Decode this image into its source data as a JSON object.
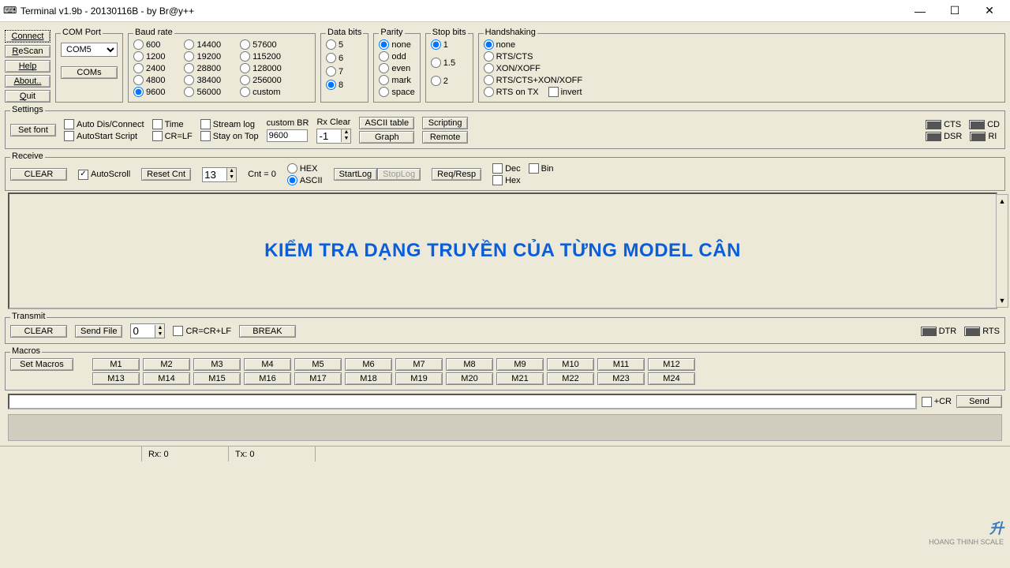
{
  "window": {
    "title": "Terminal v1.9b - 20130116B - by Br@y++"
  },
  "leftbuttons": {
    "connect": "Connect",
    "rescan": "ReScan",
    "help": "Help",
    "about": "About..",
    "quit": "Quit"
  },
  "comport": {
    "title": "COM Port",
    "selected": "COM5",
    "coms_btn": "COMs"
  },
  "baud": {
    "title": "Baud rate",
    "c1": [
      "600",
      "1200",
      "2400",
      "4800",
      "9600"
    ],
    "c2": [
      "14400",
      "19200",
      "28800",
      "38400",
      "56000"
    ],
    "c3": [
      "57600",
      "115200",
      "128000",
      "256000",
      "custom"
    ],
    "selected": "9600"
  },
  "databits": {
    "title": "Data bits",
    "opts": [
      "5",
      "6",
      "7",
      "8"
    ],
    "selected": "8"
  },
  "parity": {
    "title": "Parity",
    "opts": [
      "none",
      "odd",
      "even",
      "mark",
      "space"
    ],
    "selected": "none"
  },
  "stopbits": {
    "title": "Stop bits",
    "opts": [
      "1",
      "1.5",
      "2"
    ],
    "selected": "1"
  },
  "handshaking": {
    "title": "Handshaking",
    "opts": [
      "none",
      "RTS/CTS",
      "XON/XOFF",
      "RTS/CTS+XON/XOFF",
      "RTS on TX"
    ],
    "selected": "none",
    "invert": "invert"
  },
  "settings": {
    "title": "Settings",
    "setfont": "Set font",
    "checks": {
      "autodis": "Auto Dis/Connect",
      "autostart": "AutoStart Script",
      "time": "Time",
      "crlf": "CR=LF",
      "streamlog": "Stream log",
      "stayontop": "Stay on Top"
    },
    "custombr_label": "custom BR",
    "custombr_val": "9600",
    "rxclear_label": "Rx Clear",
    "rxclear_val": "-1",
    "ascii_btn": "ASCII table",
    "graph_btn": "Graph",
    "scripting_btn": "Scripting",
    "remote_btn": "Remote",
    "leds": {
      "cts": "CTS",
      "cd": "CD",
      "dsr": "DSR",
      "ri": "RI"
    }
  },
  "receive": {
    "title": "Receive",
    "clear": "CLEAR",
    "autoscroll": "AutoScroll",
    "resetcnt": "Reset Cnt",
    "cnt_spin": "13",
    "cnt_label": "Cnt =  0",
    "hex": "HEX",
    "ascii": "ASCII",
    "ascii_selected": true,
    "startlog": "StartLog",
    "stoplog": "StopLog",
    "reqresp": "Req/Resp",
    "dec": "Dec",
    "bin": "Bin",
    "hex2": "Hex",
    "overlay": "KIỂM TRA DẠNG TRUYỀN CỦA TỪNG MODEL CÂN"
  },
  "transmit": {
    "title": "Transmit",
    "clear": "CLEAR",
    "sendfile": "Send File",
    "spin": "0",
    "crcrlf": "CR=CR+LF",
    "break": "BREAK",
    "dtr": "DTR",
    "rts": "RTS"
  },
  "macros": {
    "title": "Macros",
    "set": "Set Macros",
    "row1": [
      "M1",
      "M2",
      "M3",
      "M4",
      "M5",
      "M6",
      "M7",
      "M8",
      "M9",
      "M10",
      "M11",
      "M12"
    ],
    "row2": [
      "M13",
      "M14",
      "M15",
      "M16",
      "M17",
      "M18",
      "M19",
      "M20",
      "M21",
      "M22",
      "M23",
      "M24"
    ]
  },
  "sendbar": {
    "cr": "+CR",
    "send": "Send"
  },
  "status": {
    "rx": "Rx: 0",
    "tx": "Tx: 0"
  },
  "watermark": "HOANG THINH SCALE"
}
